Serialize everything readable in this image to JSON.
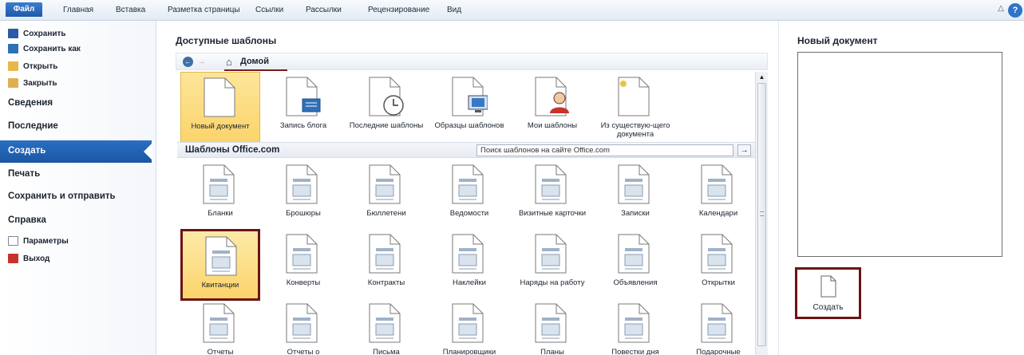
{
  "ribbon": {
    "file_tab": "Файл",
    "tabs": [
      "Главная",
      "Вставка",
      "Разметка страницы",
      "Ссылки",
      "Рассылки",
      "Рецензирование",
      "Вид"
    ]
  },
  "nav": {
    "save": "Сохранить",
    "save_as": "Сохранить как",
    "open": "Открыть",
    "close": "Закрыть",
    "info": "Сведения",
    "recent": "Последние",
    "new": "Создать",
    "print": "Печать",
    "save_send": "Сохранить и отправить",
    "help": "Справка",
    "options": "Параметры",
    "exit": "Выход"
  },
  "main": {
    "title": "Доступные шаблоны",
    "home": "Домой",
    "top_templates": [
      {
        "label": "Новый документ",
        "icon": "blank-document-icon"
      },
      {
        "label": "Запись блога",
        "icon": "blog-post-icon"
      },
      {
        "label": "Последние шаблоны",
        "icon": "recent-templates-icon"
      },
      {
        "label": "Образцы шаблонов",
        "icon": "sample-templates-icon"
      },
      {
        "label": "Мои шаблоны",
        "icon": "my-templates-icon"
      },
      {
        "label": "Из существую-щего документа",
        "icon": "from-existing-icon"
      }
    ],
    "office_label": "Шаблоны Office.com",
    "search_placeholder": "Поиск шаблонов на сайте Office.com",
    "office_row1": [
      "Бланки",
      "Брошюры",
      "Бюллетени",
      "Ведомости",
      "Визитные карточки",
      "Записки",
      "Календари"
    ],
    "office_row2": [
      "Квитанции",
      "Конверты",
      "Контракты",
      "Наклейки",
      "Наряды на работу",
      "Объявления",
      "Открытки"
    ],
    "office_row3": [
      "Отчеты",
      "Отчеты о",
      "Письма",
      "Планировщики",
      "Планы",
      "Повестки дня",
      "Подарочные"
    ]
  },
  "preview": {
    "title": "Новый документ",
    "create_label": "Создать"
  },
  "colors": {
    "selection": "#1f5aa8",
    "highlight": "#fbd46a",
    "box": "#6b1414"
  }
}
